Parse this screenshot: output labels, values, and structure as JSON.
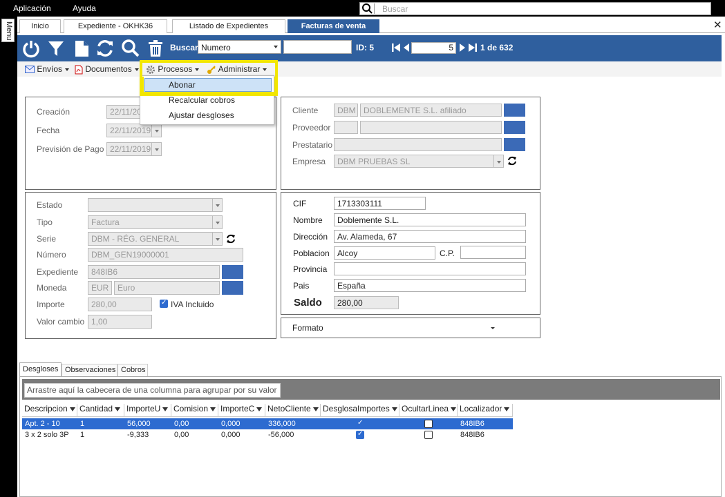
{
  "menubar": {
    "app": "Aplicación",
    "help": "Ayuda",
    "search_placeholder": "Buscar"
  },
  "side": {
    "menu": "Menu"
  },
  "tabs": [
    "Inicio",
    "Expediente  - OKHK36",
    "Listado de Expedientes",
    "Facturas de venta"
  ],
  "toolbar": {
    "buscar": "Buscar",
    "field": "Numero",
    "id_label": "ID: 5",
    "page": "5",
    "page_of": "1 de 632"
  },
  "submenu": {
    "envios": "Envíos",
    "documentos": "Documentos",
    "procesos": "Procesos",
    "administrar": "Administrar"
  },
  "popup": [
    "Abonar",
    "Recalcular cobros",
    "Ajustar desgloses"
  ],
  "dates": {
    "creacion_lbl": "Creación",
    "creacion": "22/11/2019",
    "fecha_lbl": "Fecha",
    "fecha": "22/11/2019",
    "prevision_lbl": "Previsión de Pago",
    "prevision": "22/11/2019"
  },
  "party": {
    "cliente_lbl": "Cliente",
    "cliente_code": "DBM",
    "cliente_name": "DOBLEMENTE S.L. afiliado",
    "proveedor_lbl": "Proveedor",
    "prestatario_lbl": "Prestatario",
    "empresa_lbl": "Empresa",
    "empresa": "DBM PRUEBAS SL"
  },
  "invoice": {
    "estado_lbl": "Estado",
    "tipo_lbl": "Tipo",
    "tipo": "Factura",
    "serie_lbl": "Serie",
    "serie": "DBM - RÉG. GENERAL",
    "numero_lbl": "Número",
    "numero": "DBM_GEN19000001",
    "expediente_lbl": "Expediente",
    "expediente": "848IB6",
    "moneda_lbl": "Moneda",
    "moneda_code": "EUR",
    "moneda_name": "Euro",
    "importe_lbl": "Importe",
    "importe": "280,00",
    "iva": "IVA Incluido",
    "valor_lbl": "Valor cambio",
    "valor": "1,00"
  },
  "address": {
    "cif_lbl": "CIF",
    "cif": "1713303111",
    "nombre_lbl": "Nombre",
    "nombre": "Doblemente S.L.",
    "direccion_lbl": "Dirección",
    "direccion": "Av. Alameda, 67",
    "poblacion_lbl": "Poblacion",
    "poblacion": "Alcoy",
    "cp_lbl": "C.P.",
    "provincia_lbl": "Provincia",
    "pais_lbl": "Pais",
    "pais": "España",
    "saldo_lbl": "Saldo",
    "saldo": "280,00"
  },
  "formato": "Formato",
  "bottomtabs": [
    "Desgloses",
    "Observaciones",
    "Cobros"
  ],
  "grid": {
    "group_hint": "Arrastre aquí la cabecera de una columna para agrupar por su valor",
    "columns": [
      "Descripcion",
      "Cantidad",
      "ImporteU",
      "Comision",
      "ImporteC",
      "NetoCliente",
      "DesglosaImportes",
      "OcultarLinea",
      "Localizador"
    ],
    "rows": [
      [
        "Apt. 2 - 10",
        "1",
        "56,000",
        "0,00",
        "0,000",
        "336,000",
        "on",
        "off",
        "848IB6"
      ],
      [
        "3 x 2 solo 3P",
        "1",
        "-9,333",
        "0,00",
        "0,000",
        "-56,000",
        "on",
        "off",
        "848IB6"
      ]
    ]
  },
  "colors": {
    "accent": "#2f5f9e",
    "highlight": "#f2e600",
    "select": "#2d6bd0"
  }
}
